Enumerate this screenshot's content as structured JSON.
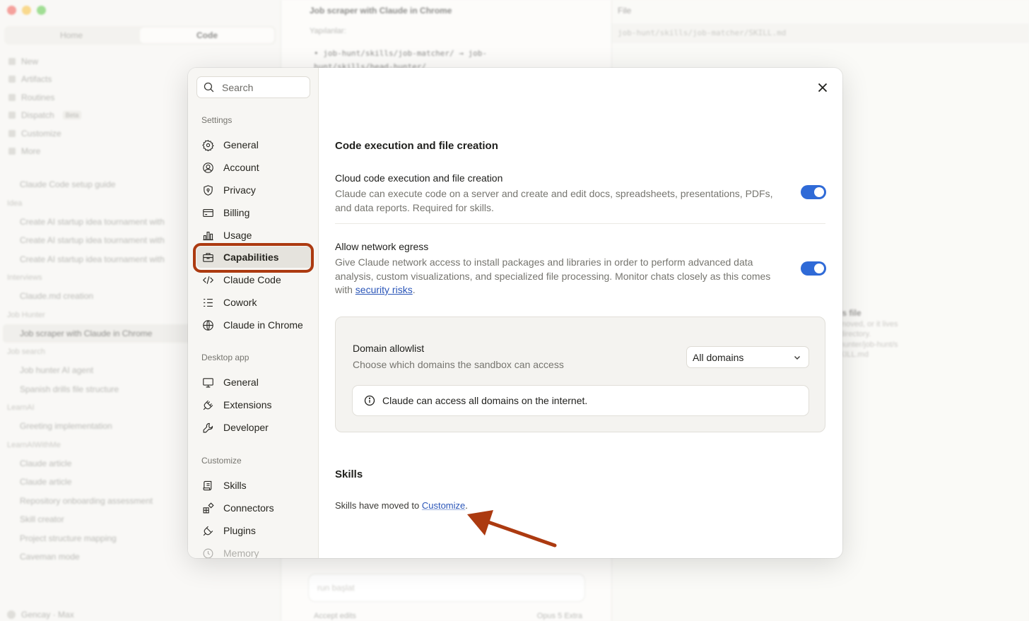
{
  "background": {
    "left_tabs": [
      "Home",
      "Code"
    ],
    "left_nav": [
      {
        "label": "New"
      },
      {
        "label": "Artifacts"
      },
      {
        "label": "Routines"
      },
      {
        "label": "Dispatch",
        "badge": "Beta"
      },
      {
        "label": "Customize"
      },
      {
        "label": "More"
      }
    ],
    "groups": [
      {
        "header": "",
        "items": [
          "Claude Code setup guide"
        ]
      },
      {
        "header": "Idea",
        "items": [
          "Create AI startup idea tournament with",
          "Create AI startup idea tournament with",
          "Create AI startup idea tournament with"
        ]
      },
      {
        "header": "Interviews",
        "items": [
          "Claude.md creation"
        ]
      },
      {
        "header": "Job Hunter",
        "items": [
          "Job scraper with Claude in Chrome"
        ]
      },
      {
        "header": "Job search",
        "items": [
          "Job hunter AI agent",
          "Spanish drills file structure"
        ]
      },
      {
        "header": "LearnAI",
        "items": [
          "Greeting implementation"
        ]
      },
      {
        "header": "LearnAIWithMe",
        "items": [
          "Claude article",
          "Claude article",
          "Repository onboarding assessment",
          "Skill creator",
          "Project structure mapping",
          "Caveman mode"
        ]
      }
    ],
    "user": "Gencay · Max",
    "mid_title": "Job scraper with Claude in Chrome",
    "mid_sub": "Yapılanlar:",
    "mid_code": "• job-hunt/skills/job-matcher/ → job-hunt/skills/head-hunter/",
    "mid_input_placeholder": "run başlat",
    "mid_bar_left": "Accept edits",
    "mid_bar_right": "Opus 5   Extra",
    "right_title": "File",
    "right_path": "job-hunt/skills/job-matcher/SKILL.md",
    "right_peek_title": "is file",
    "right_peek_lines": [
      "moved, or it lives",
      "directory.",
      "hunter/job-hunt/s",
      "KILL.md"
    ]
  },
  "modal": {
    "search_placeholder": "Search",
    "sidebar": {
      "settings_header": "Settings",
      "settings_items": [
        {
          "label": "General",
          "icon": "gear-icon"
        },
        {
          "label": "Account",
          "icon": "user-circle-icon"
        },
        {
          "label": "Privacy",
          "icon": "shield-icon"
        },
        {
          "label": "Billing",
          "icon": "credit-card-icon"
        },
        {
          "label": "Usage",
          "icon": "bar-chart-icon"
        },
        {
          "label": "Capabilities",
          "icon": "briefcase-icon",
          "active": true
        },
        {
          "label": "Claude Code",
          "icon": "code-icon"
        },
        {
          "label": "Cowork",
          "icon": "checklist-icon"
        },
        {
          "label": "Claude in Chrome",
          "icon": "globe-icon"
        }
      ],
      "desktop_header": "Desktop app",
      "desktop_items": [
        {
          "label": "General",
          "icon": "monitor-icon"
        },
        {
          "label": "Extensions",
          "icon": "plug-icon"
        },
        {
          "label": "Developer",
          "icon": "wrench-icon"
        }
      ],
      "customize_header": "Customize",
      "customize_items": [
        {
          "label": "Skills",
          "icon": "scroll-icon"
        },
        {
          "label": "Connectors",
          "icon": "grid-icon"
        },
        {
          "label": "Plugins",
          "icon": "plug-icon"
        },
        {
          "label": "Memory",
          "icon": "memory-icon"
        }
      ]
    },
    "main": {
      "section_title": "Code execution and file creation",
      "cloud": {
        "title": "Cloud code execution and file creation",
        "desc": "Claude can execute code on a server and create and edit docs, spreadsheets, presentations, PDFs, and data reports. Required for skills.",
        "enabled": true
      },
      "egress": {
        "title": "Allow network egress",
        "desc_before": "Give Claude network access to install packages and libraries in order to perform advanced data analysis, custom visualizations, and specialized file processing. Monitor chats closely as this comes with ",
        "link": "security risks",
        "desc_after": ".",
        "enabled": true
      },
      "allowlist": {
        "title": "Domain allowlist",
        "desc": "Choose which domains the sandbox can access",
        "selected": "All domains",
        "info": "Claude can access all domains on the internet."
      },
      "skills": {
        "title": "Skills",
        "text": "Skills have moved to ",
        "link": "Customize",
        "after": "."
      }
    }
  },
  "colors": {
    "accent": "#2f6ad7",
    "annotation": "#ac3a10",
    "link": "#2a55b8"
  }
}
